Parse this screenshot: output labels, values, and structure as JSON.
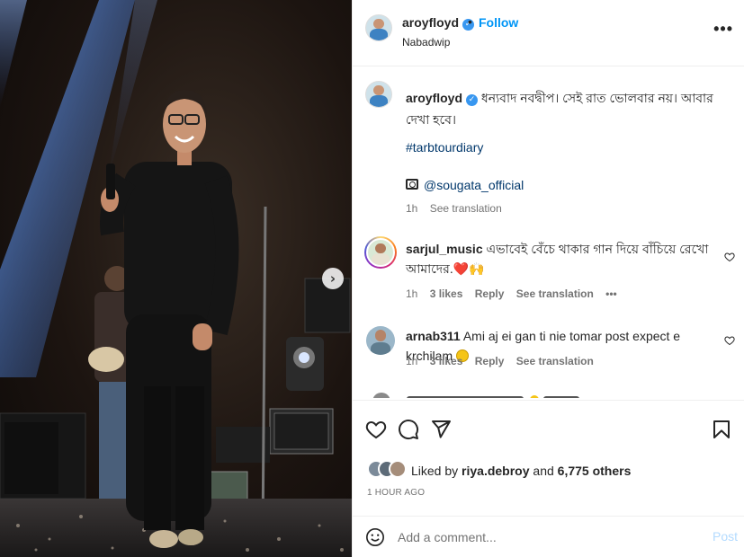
{
  "post": {
    "username": "aroyfloyd",
    "dot": "•",
    "follow_label": "Follow",
    "location": "Nabadwip",
    "more_label": "•••",
    "next_label": "›"
  },
  "caption": {
    "username": "aroyfloyd",
    "text": "ধন্যবাদ নবদ্বীপ। সেই রাত ভোলবার নয়। আবার দেখা হবে।",
    "hashtag": "#tarbtourdiary",
    "mention": "@sougata_official",
    "time": "1h",
    "see_translation": "See translation"
  },
  "comments": [
    {
      "username": "sarjul_music",
      "text": "এভাবেই বেঁচে থাকার গান দিয়ে বাঁচিয়ে রেখো আমাদের.",
      "emoji": "❤️🙌",
      "time": "1h",
      "likes": "3 likes",
      "reply": "Reply",
      "see_translation": "See translation",
      "more": "•••"
    },
    {
      "username": "arnab311",
      "text": "Ami aj ei gan ti nie tomar post expect e krchilam",
      "time": "1h",
      "likes": "3 likes",
      "reply": "Reply",
      "see_translation": "See translation"
    }
  ],
  "likes": {
    "prefix": "Liked by",
    "user": "riya.debroy",
    "and": "and",
    "others": "6,775 others"
  },
  "timestamp": "1 HOUR AGO",
  "add_comment": {
    "placeholder": "Add a comment...",
    "post_label": "Post"
  },
  "colors": {
    "accent": "#0095f6",
    "link": "#00376b",
    "verified": "#3897f0",
    "muted": "#737373",
    "heart": "#ed4956"
  },
  "icons": [
    "heart-icon",
    "comment-icon",
    "share-icon",
    "bookmark-icon",
    "smile-icon",
    "verified-icon",
    "camera-icon",
    "more-icon",
    "chevron-right-icon"
  ]
}
